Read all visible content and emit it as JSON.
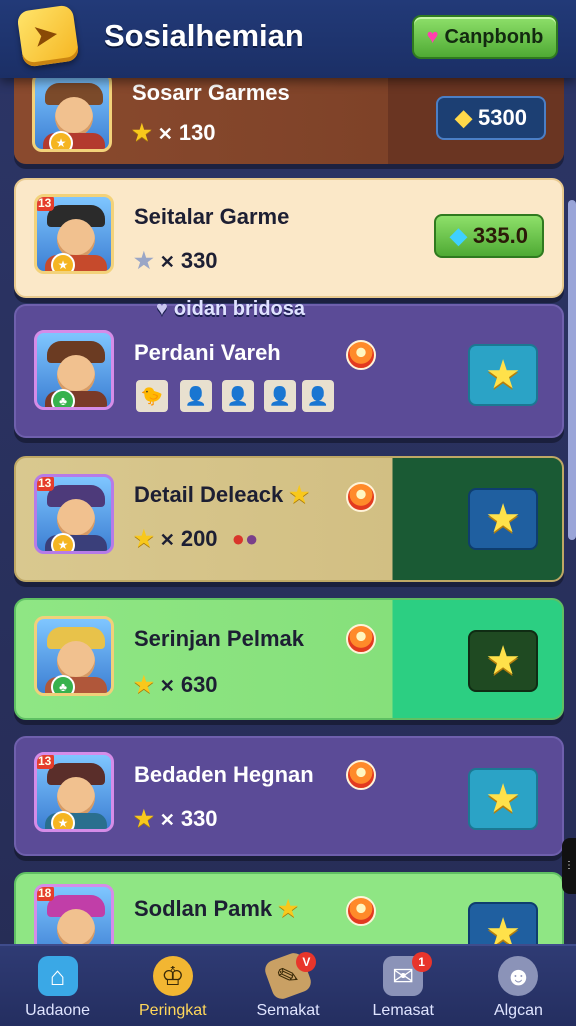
{
  "header": {
    "title": "Sosialhemian",
    "button_label": "Canpbonb"
  },
  "floating_label": "oidan bridosa",
  "cards": [
    {
      "name": "Sosarr Garmes",
      "count": "130",
      "reward": "5300",
      "level": ""
    },
    {
      "name": "Seitalar Garme",
      "count": "330",
      "reward": "335.0",
      "level": "13"
    },
    {
      "name": "Perdani Vareh",
      "count": "",
      "reward": "",
      "level": ""
    },
    {
      "name": "Detail Deleack",
      "count": "200",
      "reward": "",
      "level": "13"
    },
    {
      "name": "Serinjan Pelmak",
      "count": "630",
      "reward": "",
      "level": ""
    },
    {
      "name": "Bedaden Hegnan",
      "count": "330",
      "reward": "",
      "level": "13"
    },
    {
      "name": "Sodlan Pamk",
      "count": "",
      "reward": "",
      "level": "18"
    }
  ],
  "nav": [
    {
      "label": "Uadaone",
      "icon": "home-icon"
    },
    {
      "label": "Peringkat",
      "icon": "trophy-icon"
    },
    {
      "label": "Semakat",
      "icon": "ticket-icon",
      "badge": "V"
    },
    {
      "label": "Lemasat",
      "icon": "chat-icon",
      "badge": "1"
    },
    {
      "label": "Algcan",
      "icon": "profile-icon"
    }
  ]
}
